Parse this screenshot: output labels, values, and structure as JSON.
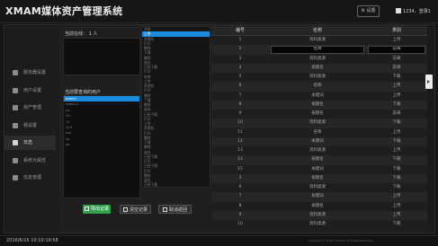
{
  "header": {
    "title": "XMAM媒体资产管理系统",
    "settings_label": "设置",
    "user_info": "1234、登录1"
  },
  "sidebar": {
    "items": [
      {
        "label": "服务器设置",
        "icon": "monitor-icon"
      },
      {
        "label": "用户设置",
        "icon": "user-icon"
      },
      {
        "label": "资产管理",
        "icon": "asset-icon"
      },
      {
        "label": "我设置",
        "icon": "person-icon"
      },
      {
        "label": "日志",
        "icon": "log-icon"
      },
      {
        "label": "系统大属性",
        "icon": "system-icon"
      },
      {
        "label": "信息管理",
        "icon": "info-icon"
      }
    ],
    "active_index": 4
  },
  "middle": {
    "current_label": "当前在线： 1  人",
    "users_label": "当前要查询的用户",
    "user_list": [
      "admin",
      "admin1",
      "xx",
      "10",
      "11",
      "2x3",
      "zxx",
      "xx",
      "xx"
    ],
    "selected_user_index": 0,
    "dropdown": [
      "名称",
      "上传",
      "资源包",
      "打印",
      "删除",
      "下载",
      "删除",
      "退出",
      "已经下载",
      "打印",
      "修改",
      "上传",
      "资源包",
      "打印",
      "删除",
      "下载",
      "删除",
      "退出",
      "已经下载",
      "打印",
      "上传",
      "资源包",
      "打印",
      "删除",
      "下载",
      "删除",
      "退出",
      "已经下载",
      "打印",
      "已经下载",
      "打印",
      "删除",
      "退出",
      "已经下载"
    ],
    "dropdown_selected_index": 1,
    "buttons": {
      "export": "导出记录",
      "clear": "清空记录",
      "cancel": "取消返回"
    }
  },
  "table": {
    "headers": [
      "编号",
      "名称",
      "类别"
    ],
    "rows": [
      [
        "1",
        "资料类源",
        "上传"
      ],
      [
        "2",
        "名称",
        "前来"
      ],
      [
        "3",
        "资料类源",
        "前来"
      ],
      [
        "4",
        "按键名",
        "前来"
      ],
      [
        "5",
        "资料类源",
        "下载"
      ],
      [
        "6",
        "名称",
        "上传"
      ],
      [
        "7",
        "关键词",
        "上传"
      ],
      [
        "8",
        "按键名",
        "下载"
      ],
      [
        "9",
        "按键名",
        "前来"
      ],
      [
        "10",
        "资料类源",
        "下载"
      ],
      [
        "11",
        "名称",
        "上传"
      ],
      [
        "12",
        "关键词",
        "下载"
      ],
      [
        "13",
        "资料类源",
        "上传"
      ],
      [
        "14",
        "按键名",
        "下载"
      ],
      [
        "15",
        "关键词",
        "下载"
      ],
      [
        "3",
        "按键名",
        "下载"
      ],
      [
        "6",
        "资料类源",
        "下载"
      ],
      [
        "7",
        "关键词",
        "上传"
      ],
      [
        "8",
        "按键名",
        "上传"
      ],
      [
        "9",
        "资料类源",
        "上传"
      ],
      [
        "10",
        "资料类源",
        "下载"
      ]
    ],
    "edit_row_index": 1
  },
  "footer": {
    "datetime": "2016/6/15  10:10:19:58",
    "copyright": "Copyright © 2016 X.M.Tech All Rights Reserved."
  }
}
